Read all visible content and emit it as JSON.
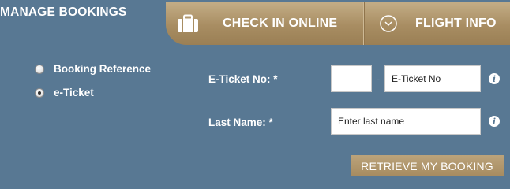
{
  "header": {
    "title": "MANAGE BOOKINGS"
  },
  "tabs": [
    {
      "label": "CHECK IN ONLINE",
      "icon": "suitcase-icon"
    },
    {
      "label": "FLIGHT INFO",
      "icon": "clock-icon"
    }
  ],
  "search_type": {
    "options": [
      {
        "label": "Booking Reference",
        "selected": false
      },
      {
        "label": "e-Ticket",
        "selected": true
      }
    ]
  },
  "form": {
    "eticket_label": "E-Ticket No: *",
    "eticket_prefix_value": "",
    "eticket_dash": "-",
    "eticket_placeholder": "E-Ticket No",
    "lastname_label": "Last Name: *",
    "lastname_placeholder": "Enter last name",
    "info_glyph": "i"
  },
  "actions": {
    "retrieve_label": "RETRIEVE MY BOOKING"
  },
  "colors": {
    "background": "#587893",
    "accent_gold": "#a88d62",
    "text": "#ffffff"
  }
}
